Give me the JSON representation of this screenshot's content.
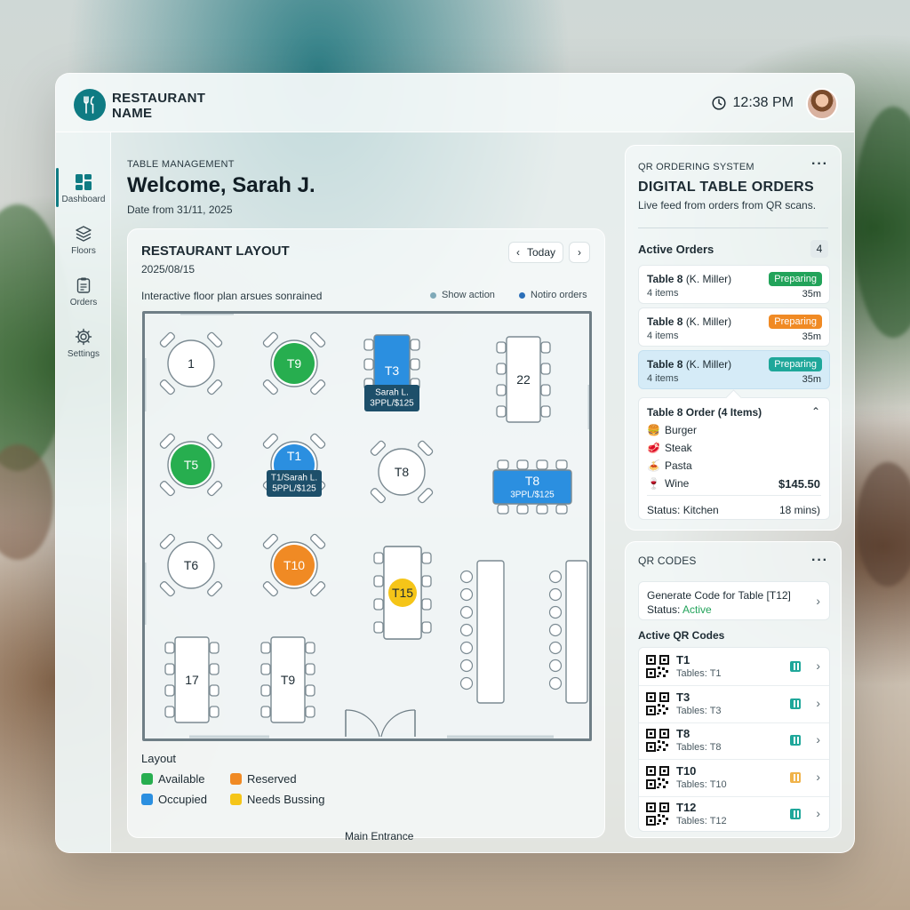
{
  "brand": {
    "name": "RESTAURANT NAME"
  },
  "header": {
    "time": "12:38 PM"
  },
  "sidebar": {
    "items": [
      {
        "label": "Dashboard",
        "icon": "dashboard-icon"
      },
      {
        "label": "Floors",
        "icon": "layers-icon"
      },
      {
        "label": "Orders",
        "icon": "clipboard-icon"
      },
      {
        "label": "Settings",
        "icon": "gear-icon"
      }
    ]
  },
  "welcome": {
    "eyebrow": "TABLE MANAGEMENT",
    "title": "Welcome, Sarah J.",
    "subtitle": "Date from 31/11, 2025"
  },
  "layout": {
    "title": "RESTAURANT LAYOUT",
    "date": "2025/08/15",
    "today_label": "Today",
    "caption": "Interactive floor plan arsues sonrained",
    "option_show": "Show action",
    "option_notify": "Notiro orders",
    "entrance": "Main Entrance",
    "legend_title": "Layout",
    "legend": [
      {
        "label": "Available",
        "color": "#27ae4f"
      },
      {
        "label": "Reserved",
        "color": "#f08a24"
      },
      {
        "label": "Occupied",
        "color": "#2b8fe0"
      },
      {
        "label": "Needs Bussing",
        "color": "#f5c518"
      }
    ],
    "tables": [
      {
        "id": "t1",
        "label": "1",
        "status": "free"
      },
      {
        "id": "t9a",
        "label": "T9",
        "status": "available"
      },
      {
        "id": "t3",
        "label": "T3",
        "status": "occupied",
        "tag_name": "Sarah L.",
        "tag_info": "3PPL/$125"
      },
      {
        "id": "t22",
        "label": "22",
        "status": "free"
      },
      {
        "id": "t5",
        "label": "T5",
        "status": "available"
      },
      {
        "id": "t1b",
        "label": "T1",
        "status": "occupied",
        "tag_name": "T1/Sarah L.",
        "tag_info": "5PPL/$125"
      },
      {
        "id": "t8a",
        "label": "T8",
        "status": "free"
      },
      {
        "id": "t8b",
        "label": "T8",
        "status": "occupied",
        "tag_info": "3PPL/$125"
      },
      {
        "id": "t6",
        "label": "T6",
        "status": "free"
      },
      {
        "id": "t10",
        "label": "T10",
        "status": "reserved"
      },
      {
        "id": "t15",
        "label": "T15",
        "status": "bussing"
      },
      {
        "id": "t17",
        "label": "17",
        "status": "free"
      },
      {
        "id": "t9b",
        "label": "T9",
        "status": "free"
      }
    ]
  },
  "orders_panel": {
    "eyebrow": "QR ORDERING SYSTEM",
    "title": "DIGITAL TABLE ORDERS",
    "description": "Live feed from orders from QR scans.",
    "active_label": "Active Orders",
    "active_count": "4",
    "orders": [
      {
        "table": "Table 8",
        "guest": "(K. Miller)",
        "items": "4 items",
        "status": "Preparing",
        "status_color": "#22a35a",
        "time": "35m"
      },
      {
        "table": "Table 8",
        "guest": "(K. Miller)",
        "items": "4 items",
        "status": "Preparing",
        "status_color": "#f08a24",
        "time": "35m"
      },
      {
        "table": "Table 8",
        "guest": "(K. Miller)",
        "items": "4 items",
        "status": "Preparing",
        "status_color": "#1fa79a",
        "time": "35m"
      }
    ],
    "detail": {
      "title": "Table 8 Order (4 Items)",
      "items": [
        {
          "name": "Burger",
          "icon": "burger-icon"
        },
        {
          "name": "Steak",
          "icon": "steak-icon"
        },
        {
          "name": "Pasta",
          "icon": "pasta-icon"
        },
        {
          "name": "Wine",
          "icon": "wine-icon"
        }
      ],
      "total": "$145.50",
      "status": "Status: Kitchen",
      "eta": "18 mins)"
    }
  },
  "qr_panel": {
    "title": "QR CODES",
    "generate_label": "Generate Code for Table [T12]",
    "generate_status_prefix": "Status: ",
    "generate_status": "Active",
    "active_label": "Active QR Codes",
    "codes": [
      {
        "name": "T1",
        "tables": "Tables: T1",
        "color": "#1fa79a"
      },
      {
        "name": "T3",
        "tables": "Tables: T3",
        "color": "#1fa79a"
      },
      {
        "name": "T8",
        "tables": "Tables: T8",
        "color": "#1fa79a"
      },
      {
        "name": "T10",
        "tables": "Tables: T10",
        "color": "#f0b34a"
      },
      {
        "name": "T12",
        "tables": "Tables: T12",
        "color": "#1fa79a"
      }
    ]
  },
  "colors": {
    "accent": "#0f7b83",
    "available": "#27ae4f",
    "occupied": "#2b8fe0",
    "reserved": "#f08a24",
    "bussing": "#f5c518"
  }
}
